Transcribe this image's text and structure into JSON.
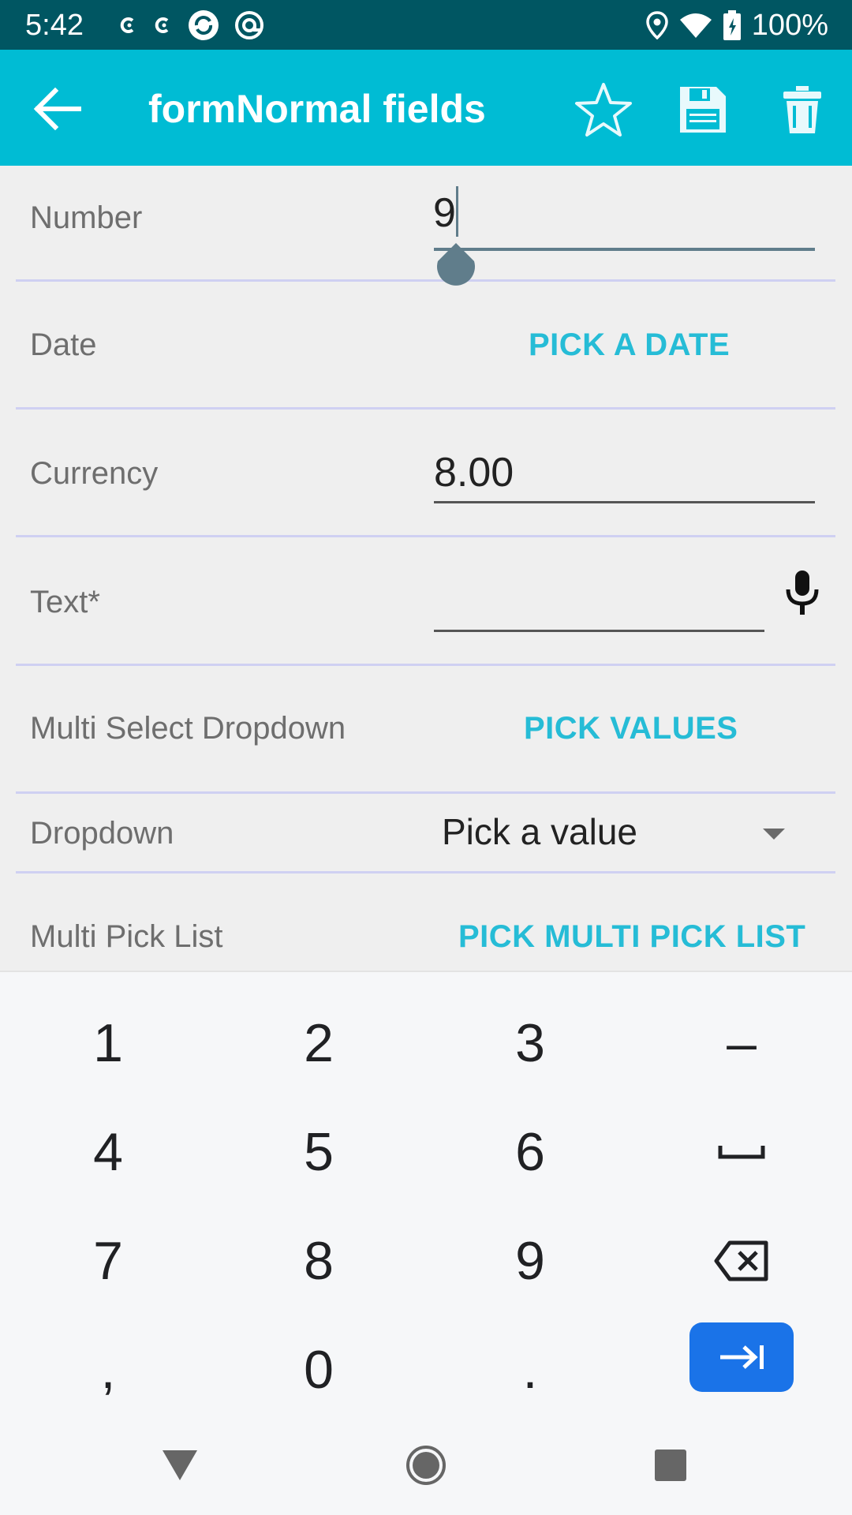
{
  "status_bar": {
    "time": "5:42",
    "battery_percent": "100%",
    "icons": [
      "notification-icon",
      "notification-icon",
      "sync-icon",
      "at-icon",
      "location-icon",
      "wifi-icon",
      "battery-icon"
    ]
  },
  "app_bar": {
    "title": "formNormal fields",
    "color": "#00bcd4",
    "actions": [
      "star-icon",
      "save-icon",
      "delete-icon"
    ]
  },
  "form": {
    "number": {
      "label": "Number",
      "value": "9"
    },
    "date": {
      "label": "Date",
      "button": "PICK A DATE"
    },
    "currency": {
      "label": "Currency",
      "value": "8.00"
    },
    "text": {
      "label": "Text*",
      "value": ""
    },
    "multi_select": {
      "label": "Multi Select Dropdown",
      "button": "PICK VALUES"
    },
    "dropdown": {
      "label": "Dropdown",
      "value": "Pick a value"
    },
    "multi_pick": {
      "label": "Multi Pick List",
      "button": "PICK MULTI PICK LIST"
    }
  },
  "keyboard": {
    "keys": [
      "1",
      "2",
      "3",
      "–",
      "4",
      "5",
      "6",
      "␣",
      "7",
      "8",
      "9",
      "⌫",
      ",",
      "0",
      ".",
      "⇥"
    ],
    "accent": "#1a73e8"
  },
  "nav": [
    "back-icon",
    "home-icon",
    "recents-icon"
  ]
}
